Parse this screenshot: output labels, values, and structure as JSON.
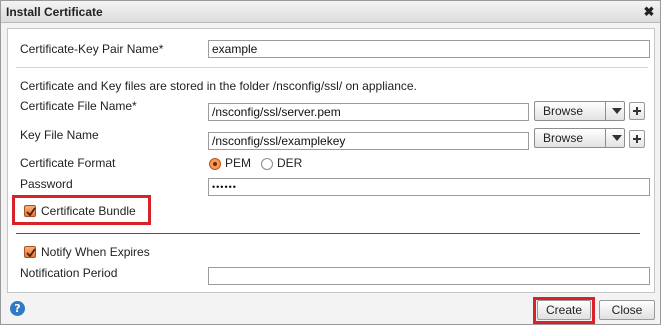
{
  "dialog": {
    "title": "Install Certificate",
    "close_icon": "close-icon"
  },
  "form": {
    "pair_name_label": "Certificate-Key Pair Name*",
    "pair_name_value": "example",
    "info_text": "Certificate and Key files are stored in the folder /nsconfig/ssl/ on appliance.",
    "cert_file_label": "Certificate File Name*",
    "cert_file_value": "/nsconfig/ssl/server.pem",
    "key_file_label": "Key File Name",
    "key_file_value": "/nsconfig/ssl/examplekey",
    "browse_label": "Browse",
    "format_label": "Certificate Format",
    "format_options": [
      "PEM",
      "DER"
    ],
    "format_selected": "PEM",
    "password_label": "Password",
    "password_value": "••••••",
    "bundle_label": "Certificate Bundle",
    "bundle_checked": true,
    "notify_label": "Notify When Expires",
    "notify_checked": true,
    "notification_label": "Notification Period",
    "notification_value": ""
  },
  "footer": {
    "help_glyph": "?",
    "create_label": "Create",
    "close_label": "Close"
  },
  "colors": {
    "highlight": "#d8222a",
    "accent_orange": "#e07a3a",
    "help_blue": "#2f7ac6"
  }
}
